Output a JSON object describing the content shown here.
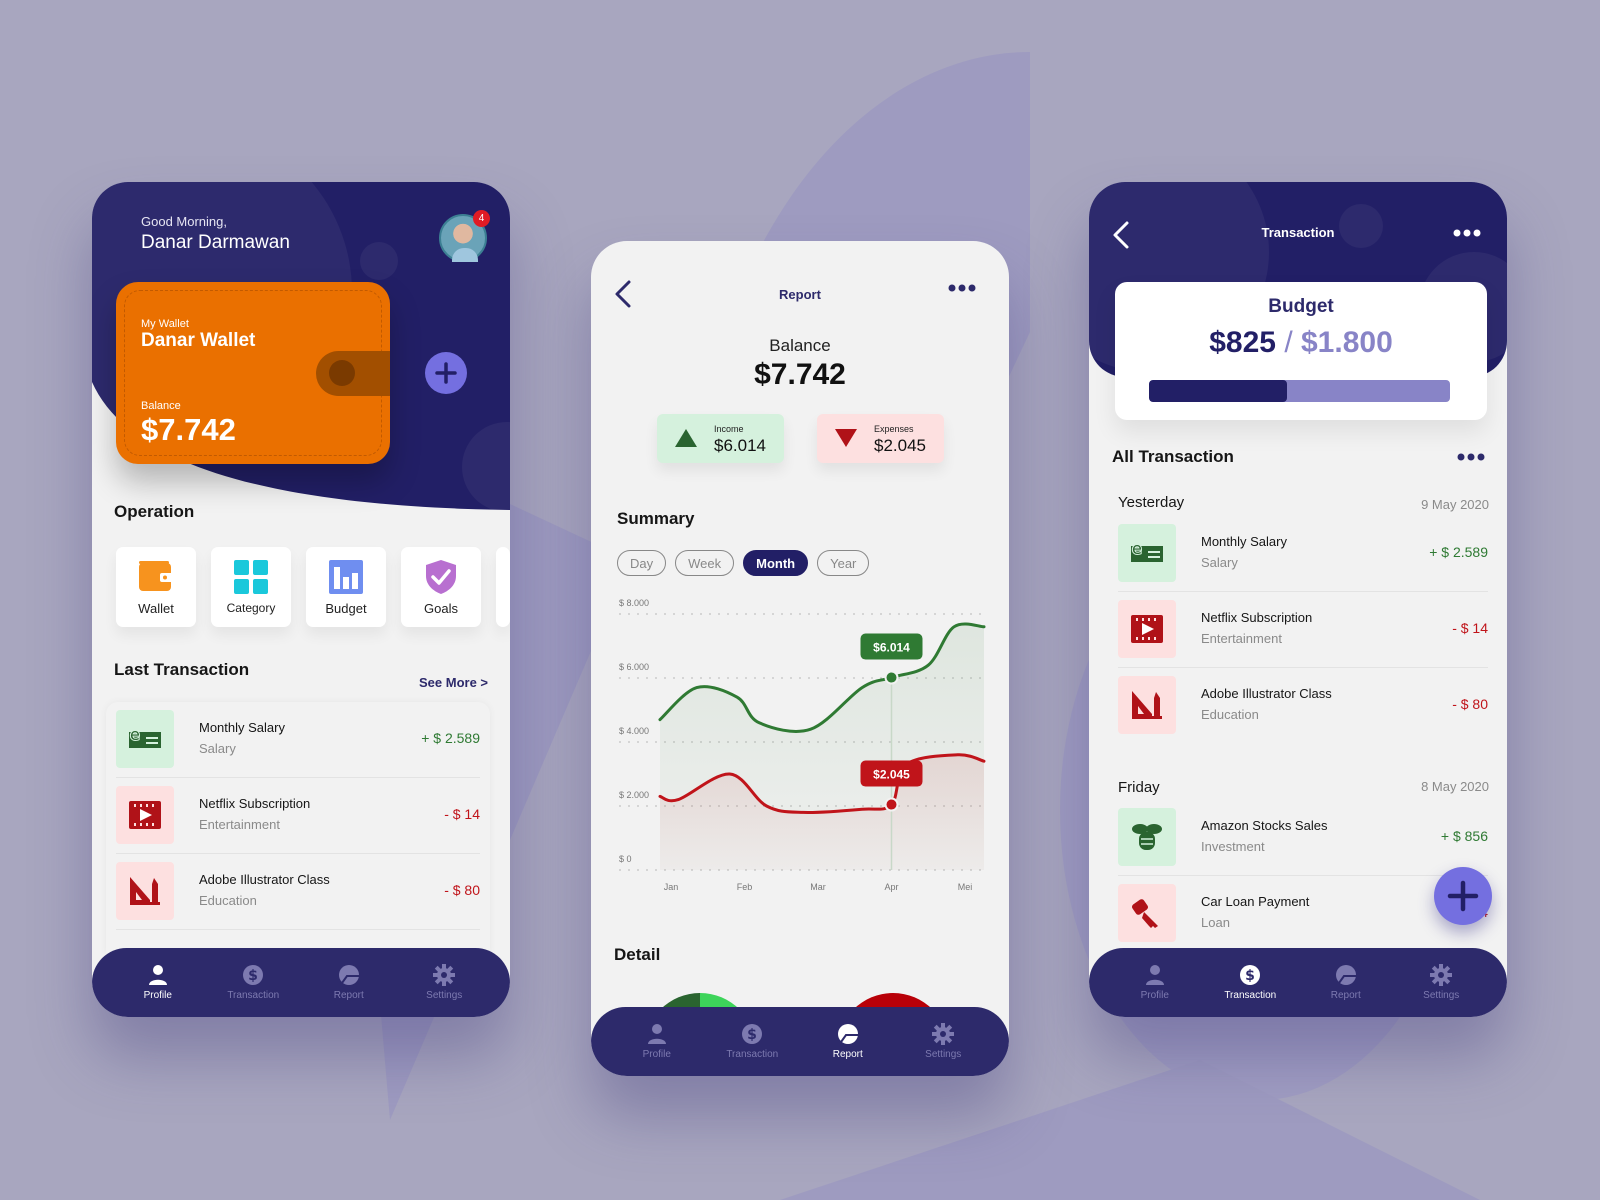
{
  "colors": {
    "navy": "#221f66",
    "nav_bg": "#2d2a6b",
    "accent_purple": "#746fe0",
    "wallet_orange": "#ea7000",
    "income_green": "#2f7a33",
    "expense_red": "#c0141a",
    "income_bg": "#d5f1dd",
    "expense_bg": "#fde0e0"
  },
  "bottom_nav": {
    "items": [
      {
        "label": "Profile",
        "icon": "profile-icon"
      },
      {
        "label": "Transaction",
        "icon": "dollar-icon"
      },
      {
        "label": "Report",
        "icon": "pie-chart-icon"
      },
      {
        "label": "Settings",
        "icon": "gear-icon"
      }
    ]
  },
  "home": {
    "greeting": "Good Morning,",
    "user_name": "Danar Darmawan",
    "notification_count": "4",
    "wallet": {
      "caption": "My Wallet",
      "name": "Danar Wallet",
      "balance_label": "Balance",
      "balance": "$7.742"
    },
    "operation_title": "Operation",
    "operations": [
      {
        "label": "Wallet",
        "icon": "wallet-icon"
      },
      {
        "label": "Category",
        "icon": "grid-icon"
      },
      {
        "label": "Budget",
        "icon": "bar-chart-icon"
      },
      {
        "label": "Goals",
        "icon": "shield-check-icon"
      }
    ],
    "last_tx_title": "Last Transaction",
    "see_more": "See More >",
    "transactions": [
      {
        "title": "Monthly Salary",
        "category": "Salary",
        "amount": "+ $ 2.589",
        "type": "in",
        "icon": "salary-icon"
      },
      {
        "title": "Netflix Subscription",
        "category": "Entertainment",
        "amount": "- $ 14",
        "type": "out",
        "icon": "film-icon"
      },
      {
        "title": "Adobe Illustrator Class",
        "category": "Education",
        "amount": "- $ 80",
        "type": "out",
        "icon": "ruler-pencil-icon"
      }
    ],
    "active_nav": "Profile"
  },
  "report": {
    "title": "Report",
    "balance_label": "Balance",
    "balance": "$7.742",
    "income": {
      "label": "Income",
      "value": "$6.014"
    },
    "expenses": {
      "label": "Expenses",
      "value": "$2.045"
    },
    "summary_title": "Summary",
    "periods": [
      "Day",
      "Week",
      "Month",
      "Year"
    ],
    "selected_period": "Month",
    "detail_title": "Detail",
    "active_nav": "Report"
  },
  "chart_data": {
    "type": "area",
    "title": "Summary",
    "xlabel": "",
    "ylabel": "",
    "categories": [
      "Jan",
      "Feb",
      "Mar",
      "Apr",
      "Mei"
    ],
    "x_extended": [
      0,
      0.5,
      1,
      1.5,
      2,
      3,
      3.5,
      4.2
    ],
    "ylim": [
      0,
      8000
    ],
    "yticks": [
      0,
      2000,
      4000,
      6000,
      8000
    ],
    "ytick_labels": [
      "$ 0",
      "$ 2.000",
      "$ 4.000",
      "$ 6.000",
      "$ 8.000"
    ],
    "grid": true,
    "series": [
      {
        "name": "Income",
        "color": "#2f7a33",
        "points": [
          [
            -0.15,
            4700
          ],
          [
            0.35,
            5700
          ],
          [
            0.9,
            5400
          ],
          [
            1.2,
            4600
          ],
          [
            1.9,
            4400
          ],
          [
            2.6,
            5700
          ],
          [
            3.0,
            6014
          ],
          [
            3.5,
            6400
          ],
          [
            3.85,
            7600
          ],
          [
            4.3,
            7600
          ]
        ],
        "highlight": {
          "x": "Apr",
          "value": 6014,
          "label": "$6.014"
        }
      },
      {
        "name": "Expenses",
        "color": "#c0141a",
        "points": [
          [
            -0.15,
            2300
          ],
          [
            0.1,
            2200
          ],
          [
            0.8,
            3000
          ],
          [
            1.3,
            2000
          ],
          [
            1.8,
            1800
          ],
          [
            2.6,
            1900
          ],
          [
            3.0,
            2045
          ],
          [
            3.2,
            3300
          ],
          [
            3.9,
            3600
          ],
          [
            4.3,
            3400
          ]
        ],
        "highlight": {
          "x": "Apr",
          "value": 2045,
          "label": "$2.045"
        }
      }
    ],
    "legend": "none"
  },
  "transaction": {
    "title": "Transaction",
    "budget": {
      "label": "Budget",
      "spent": "$825",
      "separator": "/",
      "total": "$1.800",
      "progress": 0.458
    },
    "all_title": "All Transaction",
    "groups": [
      {
        "label": "Yesterday",
        "date": "9 May 2020",
        "items": [
          {
            "title": "Monthly Salary",
            "category": "Salary",
            "amount": "+ $ 2.589",
            "type": "in",
            "icon": "salary-icon"
          },
          {
            "title": "Netflix Subscription",
            "category": "Entertainment",
            "amount": "- $ 14",
            "type": "out",
            "icon": "film-icon"
          },
          {
            "title": "Adobe Illustrator Class",
            "category": "Education",
            "amount": "- $ 80",
            "type": "out",
            "icon": "ruler-pencil-icon"
          }
        ]
      },
      {
        "label": "Friday",
        "date": "8 May 2020",
        "items": [
          {
            "title": "Amazon Stocks Sales",
            "category": "Investment",
            "amount": "+ $ 856",
            "type": "in",
            "icon": "coins-icon"
          },
          {
            "title": "Car Loan Payment",
            "category": "Loan",
            "amount": "- $ 4",
            "type": "out",
            "icon": "car-key-icon"
          }
        ]
      }
    ],
    "active_nav": "Transaction"
  }
}
